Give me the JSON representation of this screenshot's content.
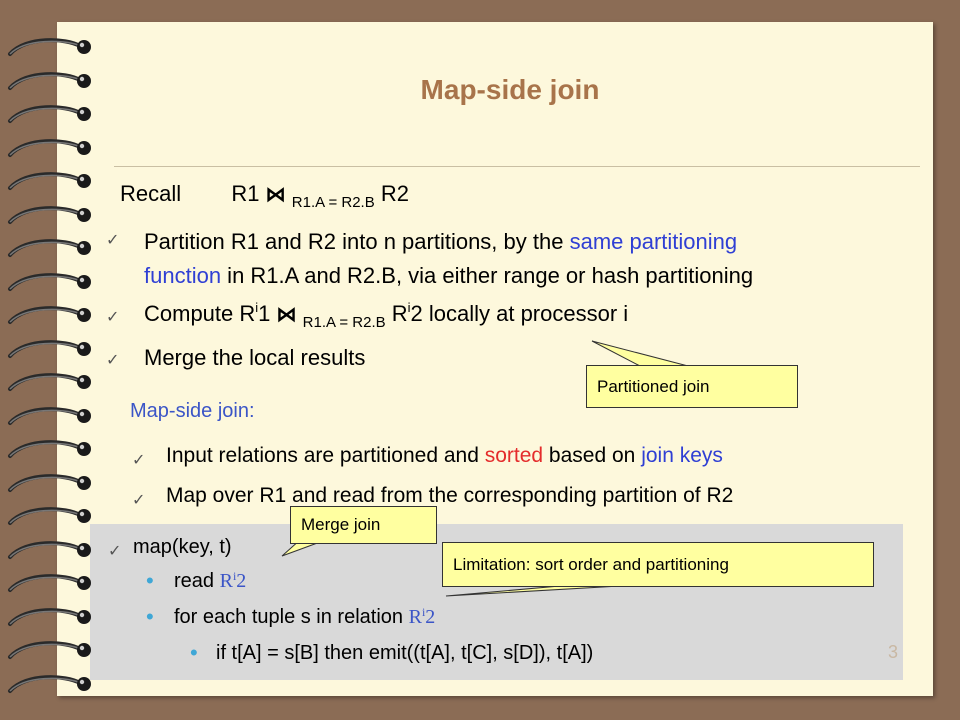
{
  "slide": {
    "title": "Map-side join",
    "recall": {
      "label": "Recall",
      "r1": "R1",
      "join_symbol": "⋈",
      "condition": "R1.A = R2.B",
      "r2": "R2"
    },
    "bullet1": {
      "part1": "Partition R1 and R2 into n partitions, by the ",
      "highlight1": "same partitioning",
      "highlight2": "function",
      "part2": " in R1.A and R2.B, via either range or hash partitioning"
    },
    "bullet2": {
      "prefix": "Compute R",
      "sup1": "i",
      "mid1": "1 ",
      "join_symbol": "⋈",
      "condition": "R1.A = R2.B",
      "mid2": " R",
      "sup2": "i",
      "suffix": "2 locally at processor i"
    },
    "bullet3": "Merge the local results",
    "mapside_heading": "Map-side join:",
    "mapside_bullet1": {
      "part1": "Input relations are partitioned and ",
      "red": "sorted",
      "part2": " based on ",
      "blue": "join keys"
    },
    "mapside_bullet2": "Map over R1 and read from the corresponding partition of R2",
    "code": {
      "line1": "map(key, t)",
      "line2_prefix": "read ",
      "line2_rel": "R",
      "line2_sup": "i",
      "line2_num": "2",
      "line3_prefix": "for each tuple s in relation ",
      "line3_rel": "R",
      "line3_sup": "i",
      "line3_num": "2",
      "line4": "if t[A] = s[B] then emit((t[A], t[C], s[D]), t[A])"
    },
    "callouts": {
      "partitioned": "Partitioned join",
      "merge": "Merge join",
      "limitation": "Limitation: sort order and partitioning"
    },
    "page_number": "3",
    "colors": {
      "background": "#8b6c55",
      "paper": "#fdf8dc",
      "title": "#a8744a",
      "highlight_blue": "#2f3fd4",
      "highlight_red": "#e42c2c",
      "callout": "#ffffa0",
      "code_box": "#d9d9d9"
    }
  }
}
